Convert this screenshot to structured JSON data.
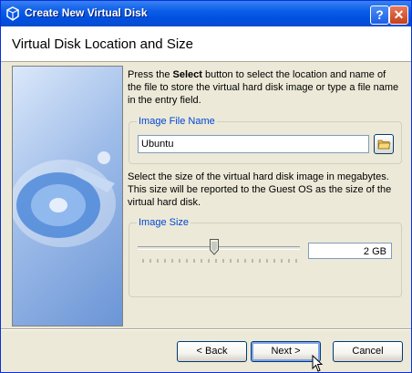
{
  "window": {
    "title": "Create New Virtual Disk",
    "help": "?",
    "close": "✕"
  },
  "header": {
    "title": "Virtual Disk Location and Size"
  },
  "intro": {
    "prefix": "Press the ",
    "bold": "Select",
    "suffix": " button to select the location and name of the file to store the virtual hard disk image or type a file name in the entry field."
  },
  "file_group": {
    "title": "Image File Name",
    "value": "Ubuntu"
  },
  "size_desc": "Select the size of the virtual hard disk image in megabytes. This size will be reported to the Guest OS as the size of the virtual hard disk.",
  "size_group": {
    "title": "Image Size",
    "value": "2 GB",
    "slider_fraction": 0.47
  },
  "buttons": {
    "back": "< Back",
    "next": "Next >",
    "cancel": "Cancel"
  }
}
